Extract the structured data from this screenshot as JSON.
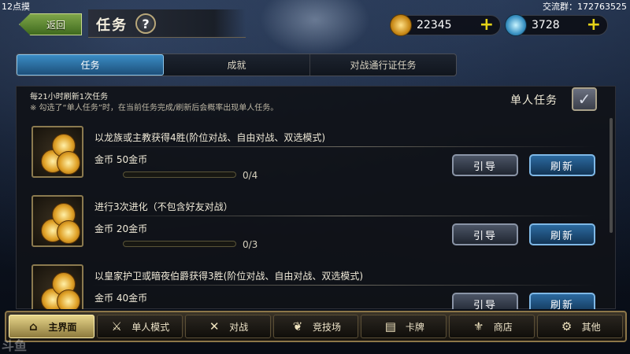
{
  "overlay": {
    "time": "12点摸",
    "group": "交流群：172763525"
  },
  "header": {
    "back_label": "返回",
    "title": "任务",
    "help_icon": "question-icon"
  },
  "currency": {
    "gold": "22345",
    "gem": "3728"
  },
  "tabs": [
    {
      "label": "任务",
      "active": true
    },
    {
      "label": "成就",
      "active": false
    },
    {
      "label": "对战通行证任务",
      "active": false
    }
  ],
  "info": {
    "refresh": "每21小时刷新1次任务",
    "note": "※ 勾选了“单人任务”时，在当前任务完成/刷新后会概率出现单人任务。"
  },
  "solo": {
    "label": "单人任务",
    "checked": true
  },
  "quests": [
    {
      "title": "以龙族或主教获得4胜(阶位对战、自由对战、双选模式)",
      "reward": "金币  50金币",
      "progress_text": "0/4",
      "progress": 0,
      "guide_label": "引导",
      "refresh_label": "刷新"
    },
    {
      "title": "进行3次进化（不包含好友对战）",
      "reward": "金币  20金币",
      "progress_text": "0/3",
      "progress": 0,
      "guide_label": "引导",
      "refresh_label": "刷新"
    },
    {
      "title": "以皇家护卫或暗夜伯爵获得3胜(阶位对战、自由对战、双选模式)",
      "reward": "金币  40金币",
      "progress_text": "",
      "progress": 0,
      "guide_label": "引导",
      "refresh_label": "刷新"
    }
  ],
  "nav": [
    {
      "label": "主界面",
      "icon": "home-icon",
      "active": true
    },
    {
      "label": "单人模式",
      "icon": "sword-icon",
      "active": false
    },
    {
      "label": "对战",
      "icon": "crossed-swords-icon",
      "active": false
    },
    {
      "label": "竞技场",
      "icon": "laurel-icon",
      "active": false
    },
    {
      "label": "卡牌",
      "icon": "cards-icon",
      "active": false
    },
    {
      "label": "商店",
      "icon": "shop-icon",
      "active": false
    },
    {
      "label": "其他",
      "icon": "menu-icon",
      "active": false
    }
  ],
  "watermark": "斗鱼"
}
